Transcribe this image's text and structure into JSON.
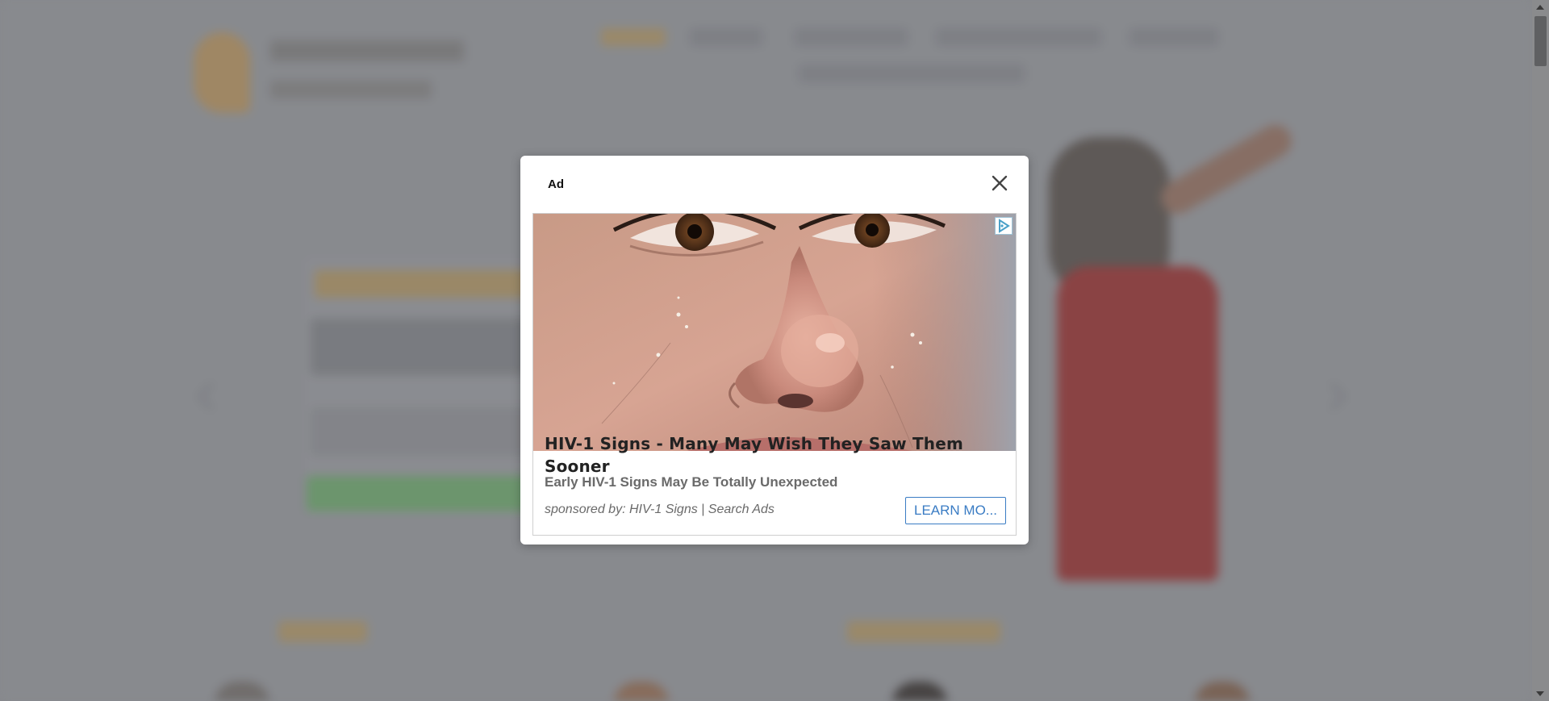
{
  "modal": {
    "title": "Ad",
    "close_icon": "close-icon"
  },
  "ad": {
    "headline": "HIV-1 Signs - Many May Wish They Saw Them Sooner",
    "subheadline": "Early HIV-1 Signs May Be Totally Unexpected",
    "sponsor": "sponsored by: HIV-1 Signs | Search Ads",
    "cta_label": "LEARN MO...",
    "choices_icon": "adchoices-icon",
    "image_subject": "close-up-face-photo"
  },
  "colors": {
    "cta": "#3a7cc4",
    "background_dim": "#8b8d91"
  }
}
